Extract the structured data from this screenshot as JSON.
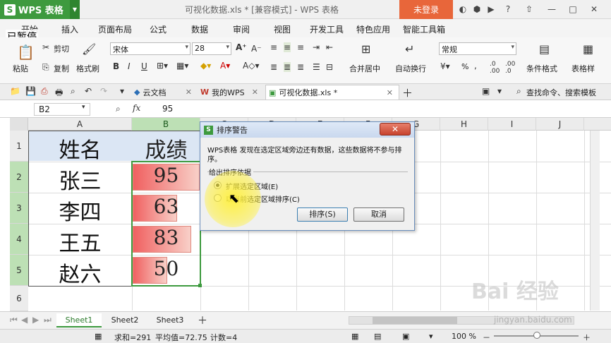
{
  "app": {
    "name": "WPS 表格",
    "logo_letter": "S",
    "doc_title": "可视化数据.xls * [兼容模式] - WPS 表格",
    "login_label": "未登录"
  },
  "menu": [
    "开始",
    "插入",
    "页面布局",
    "公式",
    "数据",
    "审阅",
    "视图",
    "开发工具",
    "特色应用",
    "智能工具箱"
  ],
  "overlay_text": "已暂停",
  "ribbon": {
    "paste": "粘贴",
    "cut": "剪切",
    "copy": "复制",
    "format_painter": "格式刷",
    "font_name": "宋体",
    "font_size": "28",
    "merge_center": "合并居中",
    "auto_wrap": "自动换行",
    "number_format": "常规",
    "percent": "%",
    "cond_format": "条件格式",
    "table_style": "表格样"
  },
  "tabs": [
    {
      "label": "云文档"
    },
    {
      "label": "我的WPS"
    },
    {
      "label": "可视化数据.xls *"
    }
  ],
  "tab_search": "查找命令、搜索模板",
  "formula_bar": {
    "name_box": "B2",
    "fx": "fx",
    "value": "95"
  },
  "columns": [
    "A",
    "B",
    "C",
    "D",
    "E",
    "F",
    "G",
    "H",
    "I",
    "J"
  ],
  "rows": [
    "1",
    "2",
    "3",
    "4",
    "5",
    "6"
  ],
  "sheet": {
    "header": {
      "a": "姓名",
      "b": "成绩"
    },
    "records": [
      {
        "name": "张三",
        "score": "95",
        "fill": 1.0
      },
      {
        "name": "李四",
        "score": "63",
        "fill": 0.66
      },
      {
        "name": "王五",
        "score": "83",
        "fill": 0.87
      },
      {
        "name": "赵六",
        "score": "50",
        "fill": 0.52
      }
    ]
  },
  "dialog": {
    "title": "排序警告",
    "message": "WPS表格 发现在选定区域旁边还有数据，这些数据将不参与排序。",
    "group_label": "给出排序依据",
    "option1": "扩展选定区域(E)",
    "option2": "以当前选定区域排序(C)",
    "sort_button": "排序(S)",
    "cancel_button": "取消"
  },
  "sheet_tabs": [
    "Sheet1",
    "Sheet2",
    "Sheet3"
  ],
  "status": {
    "sum": "求和=291",
    "avg": "平均值=72.75",
    "count": "计数=4",
    "zoom": "100 %"
  },
  "watermark": {
    "brand": "Bai 经验",
    "url": "jingyan.baidu.com"
  },
  "colors": {
    "accent": "#3d9a3e",
    "login": "#e8663a",
    "bar_start": "#f06060",
    "bar_end": "#f8d0c8"
  }
}
